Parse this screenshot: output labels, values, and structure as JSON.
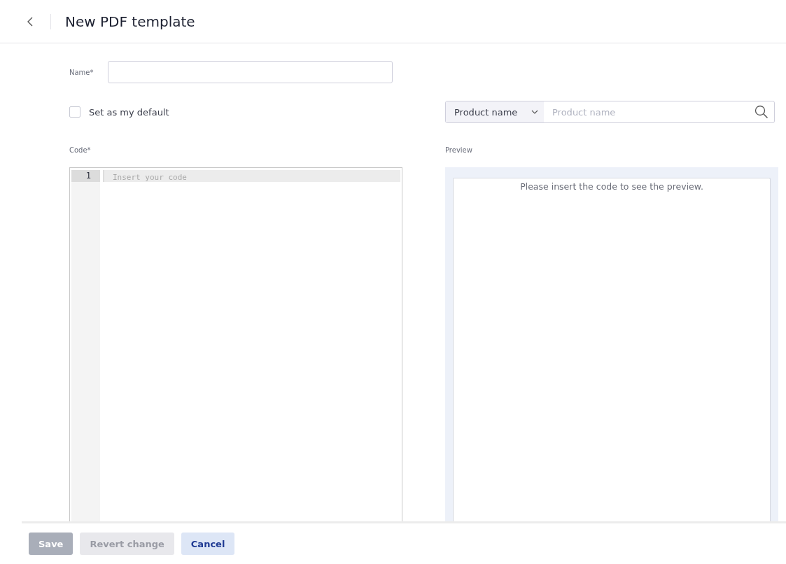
{
  "header": {
    "title": "New PDF template"
  },
  "name_field": {
    "label": "Name*"
  },
  "default_checkbox": {
    "label": "Set as my default",
    "checked": false
  },
  "product_search": {
    "filter": "Product name",
    "placeholder": "Product name"
  },
  "code_editor": {
    "label": "Code*",
    "lines": [
      {
        "number": "1",
        "placeholder": "Insert your code"
      }
    ]
  },
  "preview": {
    "label": "Preview",
    "message": "Please insert the code to see the preview."
  },
  "buttons": [
    {
      "label": "Save",
      "kind": "primary",
      "disabled": true
    },
    {
      "label": "Revert change",
      "kind": "secondary",
      "disabled": true
    },
    {
      "label": "Cancel",
      "kind": "secondary",
      "disabled": false
    }
  ]
}
